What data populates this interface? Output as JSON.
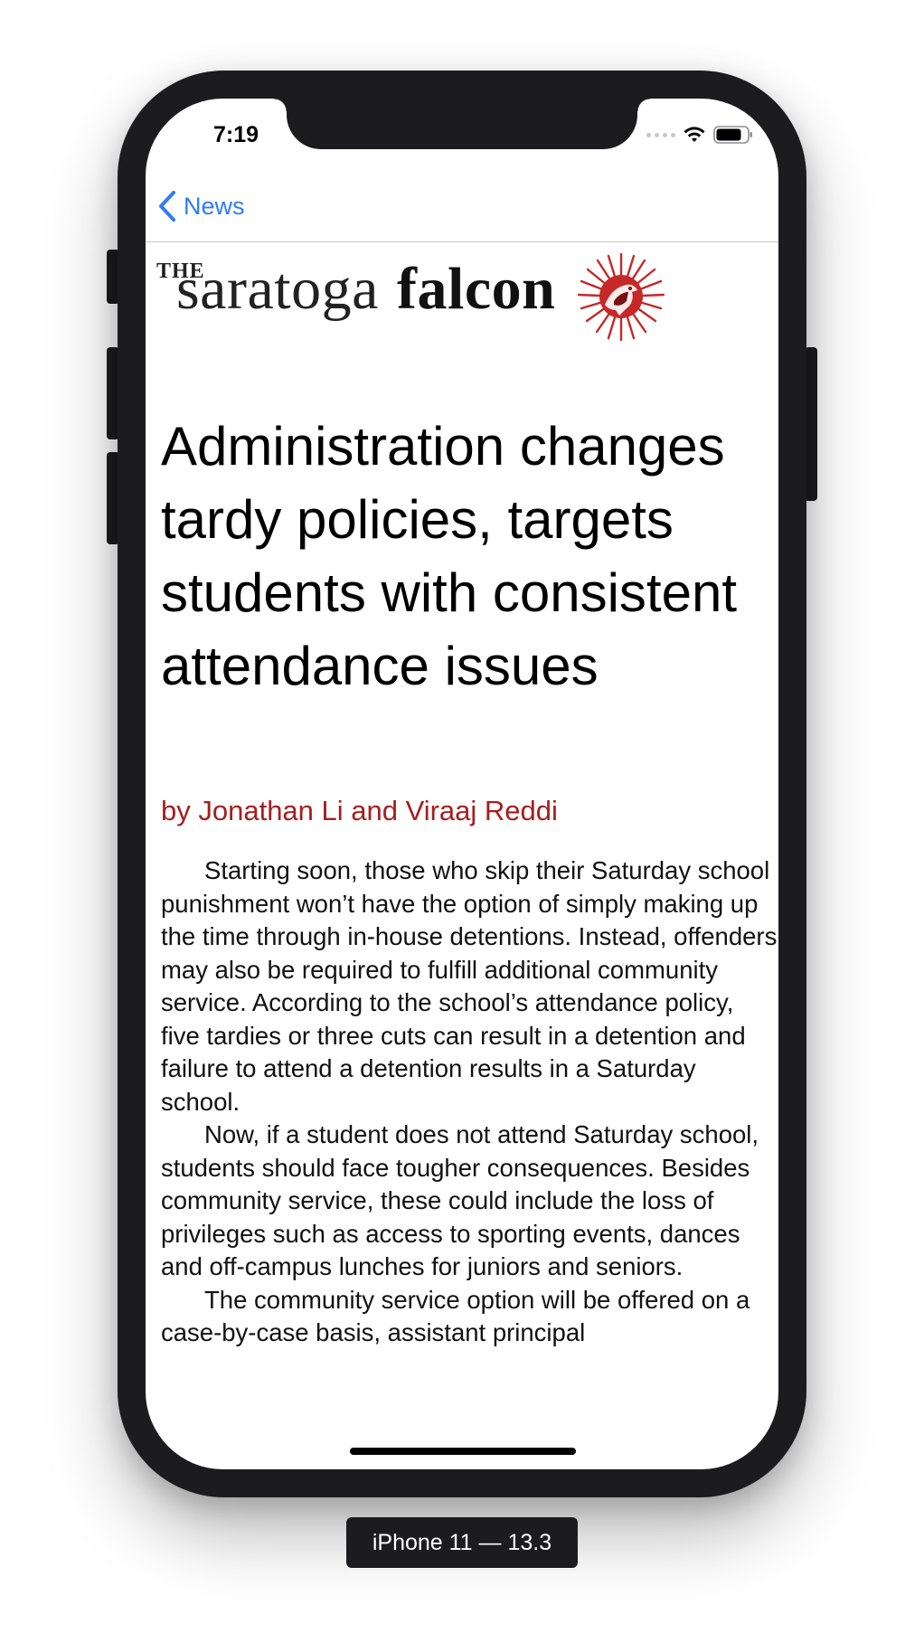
{
  "status_bar": {
    "time": "7:19",
    "icons": [
      "cellular-dots-icon",
      "wifi-icon",
      "battery-icon"
    ]
  },
  "navbar": {
    "back_icon": "chevron-left-icon",
    "back_label": "News"
  },
  "masthead": {
    "the": "THE",
    "saratoga": "saratoga",
    "falcon": "falcon",
    "emblem_icon": "falcon-emblem-icon"
  },
  "article": {
    "headline": "Administration changes tardy policies, targets students with consistent attendance issues",
    "byline": "by Jonathan Li and Viraaj Reddi",
    "paragraphs": [
      "Starting soon, those who skip their Saturday school  punishment won’t have the option of simply making up the time through in-house detentions. Instead, offenders may also be required to fulfill additional community service. According to the school’s attendance policy, five tardies or three cuts can result in a detention and failure to attend a detention results in a Saturday school.",
      "Now, if a student does not attend Saturday school, students should face tougher consequences. Besides community service, these could include the loss of privileges such as access to sporting events, dances and off-campus lunches for juniors and seniors.",
      "The community service option will be offered on a case-by-case basis, assistant principal"
    ]
  },
  "device_label": "iPhone 11 — 13.3",
  "colors": {
    "accent": "#2f7cf6",
    "byline": "#a61e1e",
    "device_frame": "#1c1c1e",
    "emblem": "#c62828"
  }
}
